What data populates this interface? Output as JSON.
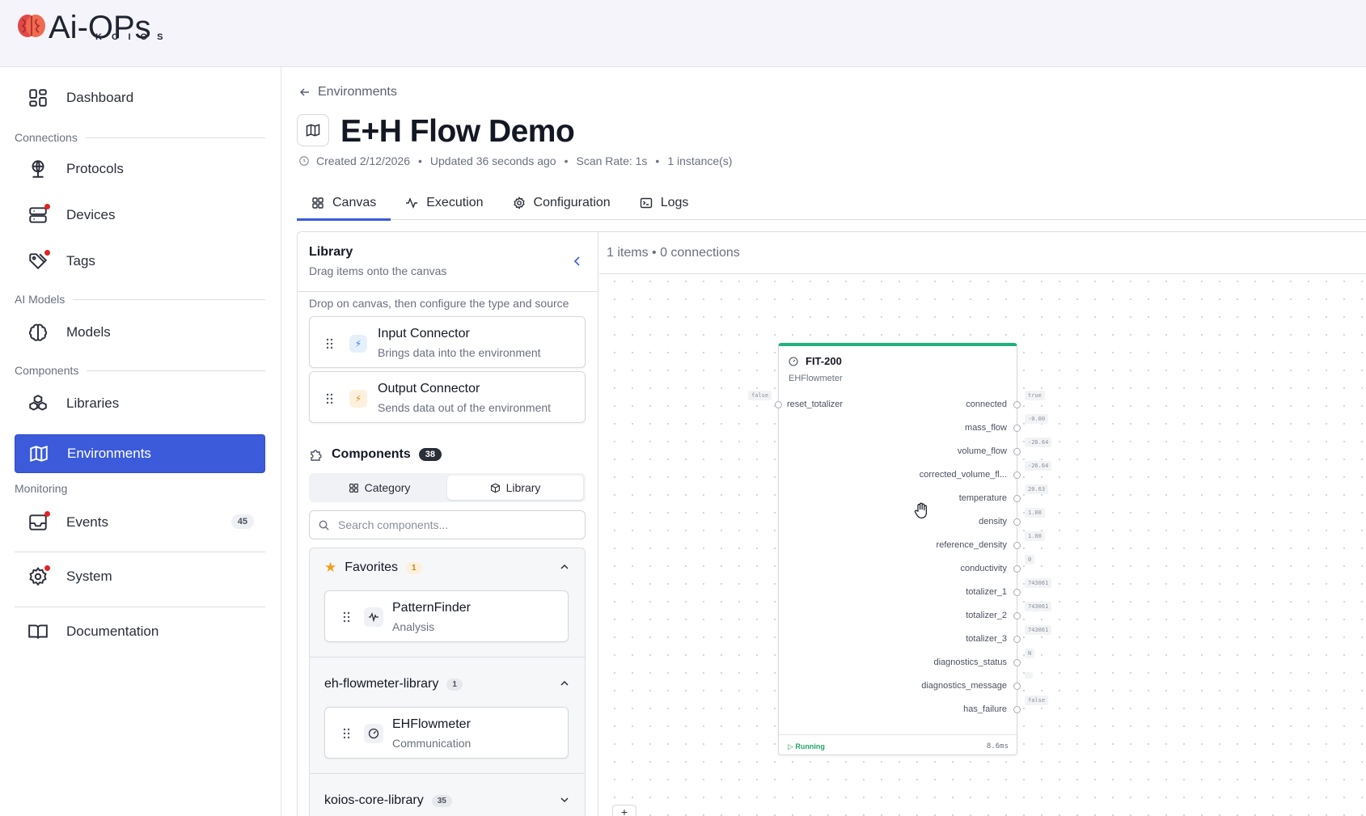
{
  "brand": {
    "name": "Ai-OPs",
    "sub": "KOIOS"
  },
  "sidebar": {
    "items": [
      {
        "label": "Dashboard"
      },
      {
        "label": "Protocols"
      },
      {
        "label": "Devices"
      },
      {
        "label": "Tags"
      },
      {
        "label": "Models"
      },
      {
        "label": "Libraries"
      },
      {
        "label": "Environments"
      },
      {
        "label": "Events",
        "badge": "45"
      },
      {
        "label": "System"
      },
      {
        "label": "Documentation"
      }
    ],
    "sections": [
      "Connections",
      "AI Models",
      "Components",
      "Monitoring"
    ]
  },
  "header": {
    "breadcrumb": "Environments",
    "title": "E+H Flow Demo",
    "created": "Created 2/12/2026",
    "updated": "Updated 36 seconds ago",
    "scan_rate": "Scan Rate: 1s",
    "instances": "1 instance(s)",
    "sep": "•"
  },
  "tabs": [
    {
      "label": "Canvas"
    },
    {
      "label": "Execution"
    },
    {
      "label": "Configuration"
    },
    {
      "label": "Logs"
    }
  ],
  "library": {
    "title": "Library",
    "subtitle": "Drag items onto the canvas",
    "hint": "Drop on canvas, then configure the type and source",
    "connectors": [
      {
        "name": "Input Connector",
        "desc": "Brings data into the environment"
      },
      {
        "name": "Output Connector",
        "desc": "Sends data out of the environment"
      }
    ],
    "components_label": "Components",
    "components_count": "38",
    "segments": [
      "Category",
      "Library"
    ],
    "search_placeholder": "Search components...",
    "groups": [
      {
        "name": "Favorites",
        "count": "1",
        "items": [
          {
            "name": "PatternFinder",
            "category": "Analysis"
          }
        ]
      },
      {
        "name": "eh-flowmeter-library",
        "count": "1",
        "items": [
          {
            "name": "EHFlowmeter",
            "category": "Communication"
          }
        ]
      },
      {
        "name": "koios-core-library",
        "count": "35",
        "items": []
      }
    ]
  },
  "canvas": {
    "status": "1 items • 0 connections",
    "node": {
      "title": "FIT-200",
      "type": "EHFlowmeter",
      "inputs": [
        {
          "name": "reset_totalizer",
          "value": "false"
        }
      ],
      "outputs": [
        {
          "name": "connected",
          "value": "true"
        },
        {
          "name": "mass_flow",
          "value": "-0.00"
        },
        {
          "name": "volume_flow",
          "value": "-26.64"
        },
        {
          "name": "corrected_volume_fl...",
          "value": "-26.64"
        },
        {
          "name": "temperature",
          "value": "20.63"
        },
        {
          "name": "density",
          "value": "1.00"
        },
        {
          "name": "reference_density",
          "value": "1.00"
        },
        {
          "name": "conductivity",
          "value": "0"
        },
        {
          "name": "totalizer_1",
          "value": "743061"
        },
        {
          "name": "totalizer_2",
          "value": "743061"
        },
        {
          "name": "totalizer_3",
          "value": "743061"
        },
        {
          "name": "diagnostics_status",
          "value": "N"
        },
        {
          "name": "diagnostics_message",
          "value": ""
        },
        {
          "name": "has_failure",
          "value": "false"
        }
      ],
      "state": "Running",
      "elapsed": "8.6ms"
    },
    "zoom_in": "+"
  },
  "colors": {
    "accent": "#3b5bdb",
    "running": "#22a06b",
    "node_top": "#22b07d",
    "alert_dot": "#e02424"
  }
}
